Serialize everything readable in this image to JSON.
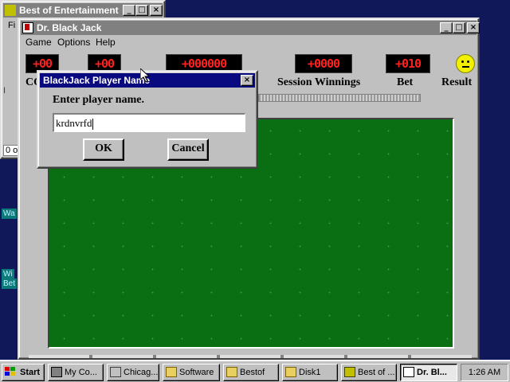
{
  "back_window": {
    "title": "Best of Entertainment",
    "menu_fragment": "Fi",
    "status_fragment": "0 o",
    "side_mark": "I"
  },
  "desktop": {
    "icons": [
      {
        "label": "Wa"
      },
      {
        "label": "Wi"
      },
      {
        "label": "Bet"
      }
    ]
  },
  "main_window": {
    "title": "Dr. Black Jack",
    "menu": [
      "Game",
      "Options",
      "Help"
    ],
    "leds": {
      "coins": "+00",
      "second": "+00",
      "total": "+000000",
      "session_winnings": "+0000",
      "bet": "+010"
    },
    "labels": {
      "coins_fragment": "CO",
      "session_winnings": "Session Winnings",
      "bet": "Bet",
      "result": "Result"
    },
    "bottom_tab_count_hint": ""
  },
  "dialog": {
    "title": "BlackJack Player Name",
    "prompt": "Enter player name.",
    "input_value": "krdnvrfd",
    "ok_label": "OK",
    "cancel_label": "Cancel"
  },
  "taskbar": {
    "start_label": "Start",
    "items": [
      {
        "label": "My Co..."
      },
      {
        "label": "Chicag..."
      },
      {
        "label": "Software"
      },
      {
        "label": "Bestof"
      },
      {
        "label": "Disk1"
      },
      {
        "label": "Best of ..."
      },
      {
        "label": "Dr. Bl..."
      }
    ],
    "clock": "1:26 AM"
  },
  "colors": {
    "titlebar_active": "#0a0a80",
    "titlebar_inactive": "#808080",
    "felt": "#0a6e12",
    "led_text": "#ff2020",
    "desktop": "#10185a"
  }
}
